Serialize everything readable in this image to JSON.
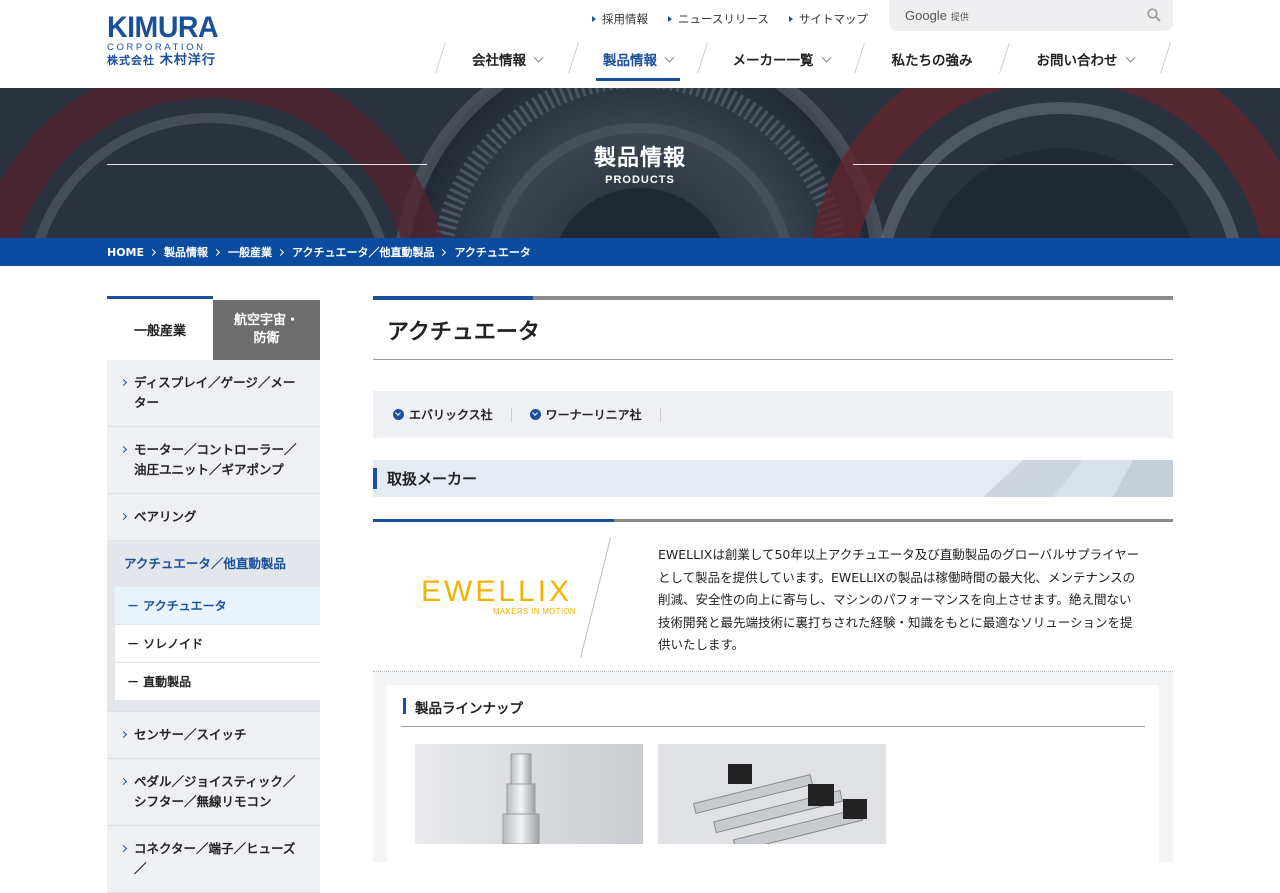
{
  "brand": {
    "name": "KIMURA",
    "corp": "CORPORATION",
    "jp_prefix": "株式会社",
    "jp_name": "木村洋行",
    "color": "#1a4f9c"
  },
  "utility_links": [
    "採用情報",
    "ニュースリリース",
    "サイトマップ"
  ],
  "search": {
    "brand": "Google",
    "suffix": "提供",
    "icon": "search-icon"
  },
  "global_nav": [
    {
      "label": "会社情報",
      "dropdown": true,
      "active": false
    },
    {
      "label": "製品情報",
      "dropdown": true,
      "active": true
    },
    {
      "label": "メーカー一覧",
      "dropdown": true,
      "active": false
    },
    {
      "label": "私たちの強み",
      "dropdown": false,
      "active": false
    },
    {
      "label": "お問い合わせ",
      "dropdown": true,
      "active": false
    }
  ],
  "hero": {
    "title": "製品情報",
    "subtitle": "PRODUCTS"
  },
  "breadcrumb": [
    "HOME",
    "製品情報",
    "一般産業",
    "アクチュエータ／他直動製品",
    "アクチュエータ"
  ],
  "sidebar": {
    "tabs": [
      {
        "label": "一般産業",
        "active": true
      },
      {
        "label": "航空宇宙・\n防衛",
        "active": false
      }
    ],
    "items": [
      {
        "label": "ディスプレイ／ゲージ／メーター"
      },
      {
        "label": "モーター／コントローラー／油圧ユニット／ギアポンプ"
      },
      {
        "label": "ベアリング"
      },
      {
        "label": "アクチュエータ／他直動製品",
        "current": true,
        "children": [
          {
            "label": "－ アクチュエータ",
            "active": true
          },
          {
            "label": "－ ソレノイド",
            "active": false
          },
          {
            "label": "－ 直動製品",
            "active": false
          }
        ]
      },
      {
        "label": "センサー／スイッチ"
      },
      {
        "label": "ペダル／ジョイスティック／シフター／無線リモコン"
      },
      {
        "label": "コネクター／端子／ヒューズ／"
      }
    ]
  },
  "main": {
    "title": "アクチュエータ",
    "anchors": [
      "エバリックス社",
      "ワーナーリニア社"
    ],
    "section_title": "取扱メーカー",
    "maker": {
      "logo_text": "EWELLIX",
      "logo_tagline": "MAKERS IN MOTION",
      "logo_color": "#f0b400",
      "description": "EWELLIXは創業して50年以上アクチュエータ及び直動製品のグローバルサプライヤーとして製品を提供しています。EWELLIXの製品は稼働時間の最大化、メンテナンスの削減、安全性の向上に寄与し、マシンのパフォーマンスを向上させます。絶え間ない技術開発と最先端技術に裏打ちされた経験・知識をもとに最適なソリューションを提供いたします。"
    },
    "lineup_title": "製品ラインナップ"
  }
}
